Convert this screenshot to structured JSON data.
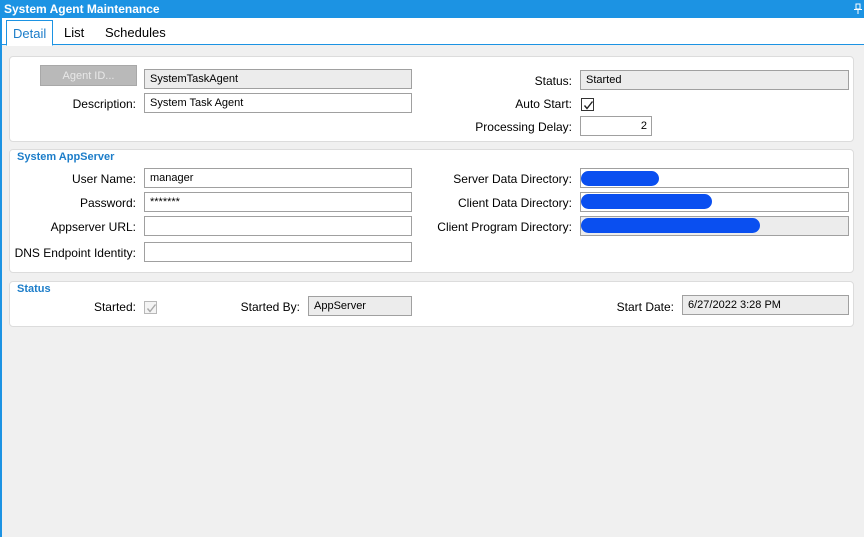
{
  "window": {
    "title": "System Agent Maintenance"
  },
  "tabs": [
    {
      "label": "Detail"
    },
    {
      "label": "List"
    },
    {
      "label": "Schedules"
    }
  ],
  "agent": {
    "agent_id_button": "Agent ID...",
    "agent_id_value": "SystemTaskAgent",
    "description_label": "Description:",
    "description_value": "System Task Agent",
    "status_label": "Status:",
    "status_value": "Started",
    "auto_start_label": "Auto Start:",
    "auto_start_checked": true,
    "processing_delay_label": "Processing Delay:",
    "processing_delay_value": "2"
  },
  "appserver": {
    "legend": "System AppServer",
    "user_name_label": "User Name:",
    "user_name_value": "manager",
    "password_label": "Password:",
    "password_value": "*******",
    "appserver_url_label": "Appserver URL:",
    "appserver_url_value": "",
    "dns_label": "DNS Endpoint Identity:",
    "dns_value": "",
    "server_data_dir_label": "Server Data Directory:",
    "client_data_dir_label": "Client Data Directory:",
    "client_program_dir_label": "Client Program Directory:",
    "redaction_color": "#0a4ff0"
  },
  "status": {
    "legend": "Status",
    "started_label": "Started:",
    "started_checked": true,
    "started_by_label": "Started By:",
    "started_by_value": "AppServer",
    "start_date_label": "Start Date:",
    "start_date_value": "6/27/2022 3:28 PM"
  },
  "colors": {
    "accent": "#1c93e3",
    "legend": "#1c7dc9"
  }
}
